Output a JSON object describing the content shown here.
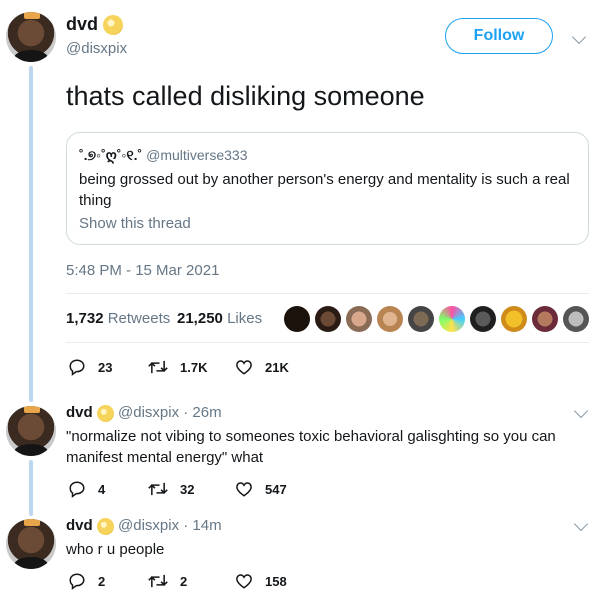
{
  "main_tweet": {
    "display_name": "dvd",
    "handle": "@disxpix",
    "follow_label": "Follow",
    "text": "thats called disliking someone",
    "quote": {
      "display_name": "˚.୭◦˚ღ˚◦୧.˚",
      "handle": "@multiverse333",
      "text": "being grossed out by another person's energy and mentality is such a real thing",
      "show_thread": "Show this thread"
    },
    "timestamp": "5:48 PM - 15 Mar 2021",
    "retweets_count": "1,732",
    "retweets_label": "Retweets",
    "likes_count": "21,250",
    "likes_label": "Likes",
    "replies": "23",
    "retweets_short": "1.7K",
    "likes_short": "21K"
  },
  "replies": [
    {
      "display_name": "dvd",
      "handle": "@disxpix",
      "time": "· 26m",
      "text": "\"normalize not vibing to someones toxic behavioral galisghting so you can manifest mental energy\" what",
      "reply_count": "4",
      "retweet_count": "32",
      "like_count": "547"
    },
    {
      "display_name": "dvd",
      "handle": "@disxpix",
      "time": "· 14m",
      "text": "who r u people",
      "reply_count": "2",
      "retweet_count": "2",
      "like_count": "158"
    }
  ],
  "colors": {
    "accent": "#1da1f2",
    "thread_line": "#bcd7ee",
    "gray_text": "#657786"
  },
  "icons": [
    "reply-icon",
    "retweet-icon",
    "like-icon",
    "chevron-down-icon",
    "verified-badge-icon"
  ]
}
